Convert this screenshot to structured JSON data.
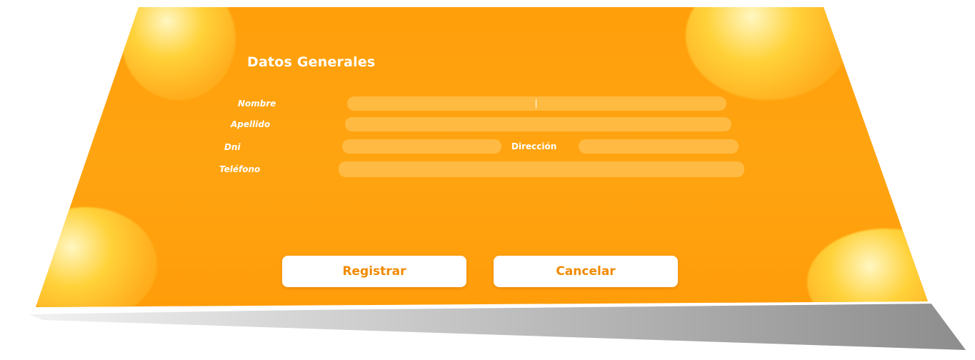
{
  "form": {
    "title": "Datos Generales",
    "fields": {
      "nombre": {
        "label": "Nombre",
        "value": ""
      },
      "apellido": {
        "label": "Apellido",
        "value": ""
      },
      "dni": {
        "label": "Dni",
        "value": ""
      },
      "direccion": {
        "label": "Dirección",
        "value": ""
      },
      "telefono": {
        "label": "Teléfono",
        "value": ""
      }
    }
  },
  "buttons": {
    "register_label": "Registrar",
    "cancel_label": "Cancelar"
  },
  "colors": {
    "background": "#ffa411",
    "field": "#ffcd6e",
    "button_text": "#f08a00",
    "button_bg": "#ffffff"
  }
}
